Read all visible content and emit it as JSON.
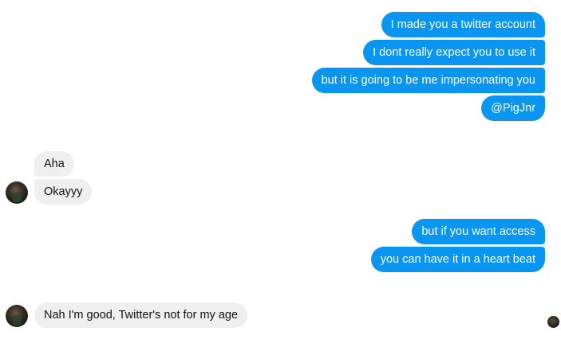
{
  "conversation": {
    "group1": [
      "I made you a twitter account",
      "I dont really expect you to use it",
      "but it is going to be me impersonating you",
      "@PigJnr"
    ],
    "group2": [
      "Aha",
      "Okayyy"
    ],
    "group3": [
      "but if you want access",
      "you can have it in a heart beat"
    ],
    "group4": [
      "Nah I'm good, Twitter's not for my age"
    ]
  },
  "colors": {
    "outgoing_bubble": "#0a96f0",
    "incoming_bubble": "#efefef",
    "background": "#ffffff"
  },
  "icons": {
    "contact_avatar": "contact-avatar-photo",
    "seen_indicator": "seen-avatar-photo"
  }
}
